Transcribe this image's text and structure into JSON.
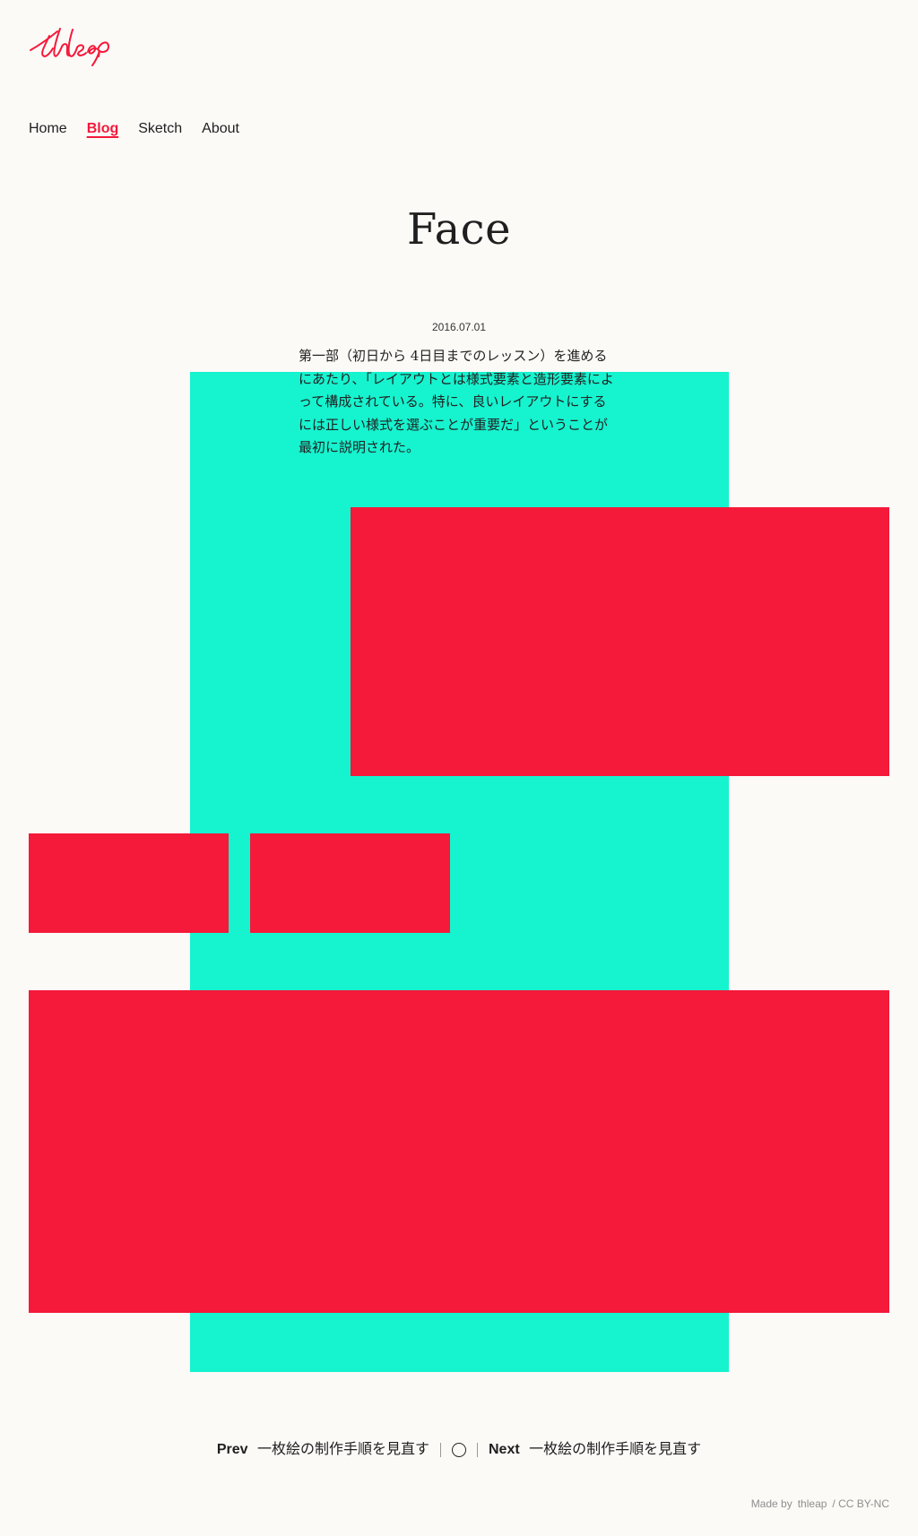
{
  "brand": {
    "logo_text": "thleap",
    "accent_color": "#f5193a",
    "secondary_color": "#16f3cf",
    "background_color": "#fbfaf7"
  },
  "nav": {
    "items": [
      {
        "label": "Home",
        "active": false
      },
      {
        "label": "Blog",
        "active": true
      },
      {
        "label": "Sketch",
        "active": false
      },
      {
        "label": "About",
        "active": false
      }
    ]
  },
  "article": {
    "title": "Face",
    "date": "2016.07.01",
    "body": "第一部（初日から 4日目までのレッスン）を進めるにあたり、「レイアウトとは様式要素と造形要素によって構成されている。特に、良いレイアウトにするには正しい様式を選ぶことが重要だ」ということが最初に説明された。"
  },
  "pager": {
    "prev_label": "Prev",
    "prev_title": "一枚絵の制作手順を見直す",
    "home_icon": "circle-icon",
    "next_label": "Next",
    "next_title": "一枚絵の制作手順を見直す"
  },
  "footer": {
    "made_by": "Made by",
    "author": "thleap",
    "license": "/ CC BY-NC"
  }
}
